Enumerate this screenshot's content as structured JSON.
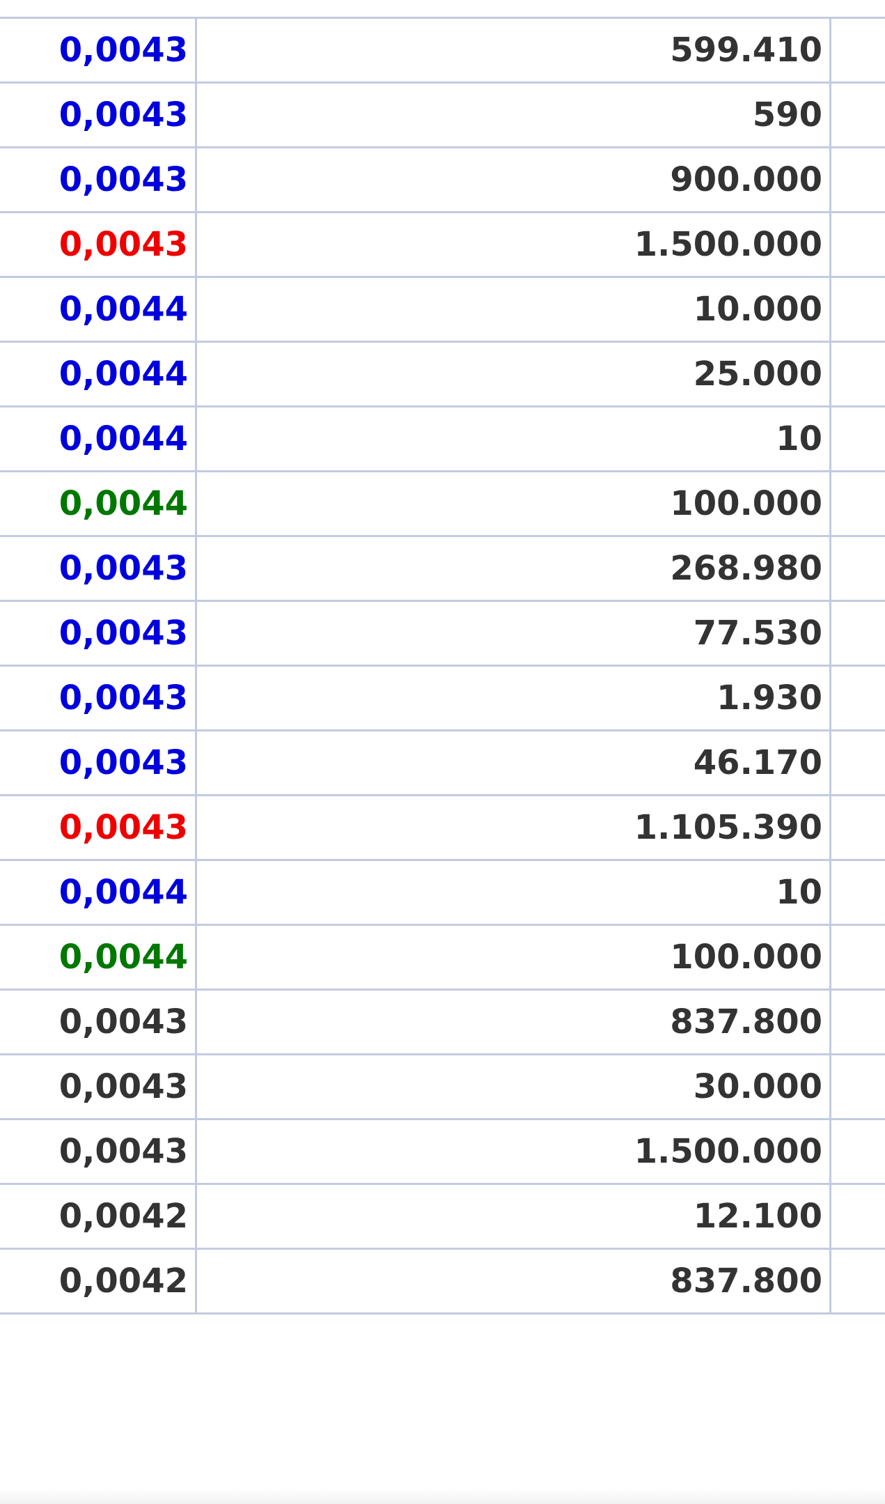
{
  "colors": {
    "blue": "#0000dd",
    "red": "#ee0000",
    "green": "#007700",
    "neutral": "#333333",
    "gridline": "#c3cbe0"
  },
  "trades": [
    {
      "price": "0,0043",
      "volume": "599.410",
      "tone": "blue"
    },
    {
      "price": "0,0043",
      "volume": "590",
      "tone": "blue"
    },
    {
      "price": "0,0043",
      "volume": "900.000",
      "tone": "blue"
    },
    {
      "price": "0,0043",
      "volume": "1.500.000",
      "tone": "red"
    },
    {
      "price": "0,0044",
      "volume": "10.000",
      "tone": "blue"
    },
    {
      "price": "0,0044",
      "volume": "25.000",
      "tone": "blue"
    },
    {
      "price": "0,0044",
      "volume": "10",
      "tone": "blue"
    },
    {
      "price": "0,0044",
      "volume": "100.000",
      "tone": "green"
    },
    {
      "price": "0,0043",
      "volume": "268.980",
      "tone": "blue"
    },
    {
      "price": "0,0043",
      "volume": "77.530",
      "tone": "blue"
    },
    {
      "price": "0,0043",
      "volume": "1.930",
      "tone": "blue"
    },
    {
      "price": "0,0043",
      "volume": "46.170",
      "tone": "blue"
    },
    {
      "price": "0,0043",
      "volume": "1.105.390",
      "tone": "red"
    },
    {
      "price": "0,0044",
      "volume": "10",
      "tone": "blue"
    },
    {
      "price": "0,0044",
      "volume": "100.000",
      "tone": "green"
    },
    {
      "price": "0,0043",
      "volume": "837.800",
      "tone": "neutral"
    },
    {
      "price": "0,0043",
      "volume": "30.000",
      "tone": "neutral"
    },
    {
      "price": "0,0043",
      "volume": "1.500.000",
      "tone": "neutral"
    },
    {
      "price": "0,0042",
      "volume": "12.100",
      "tone": "neutral"
    },
    {
      "price": "0,0042",
      "volume": "837.800",
      "tone": "neutral"
    }
  ]
}
